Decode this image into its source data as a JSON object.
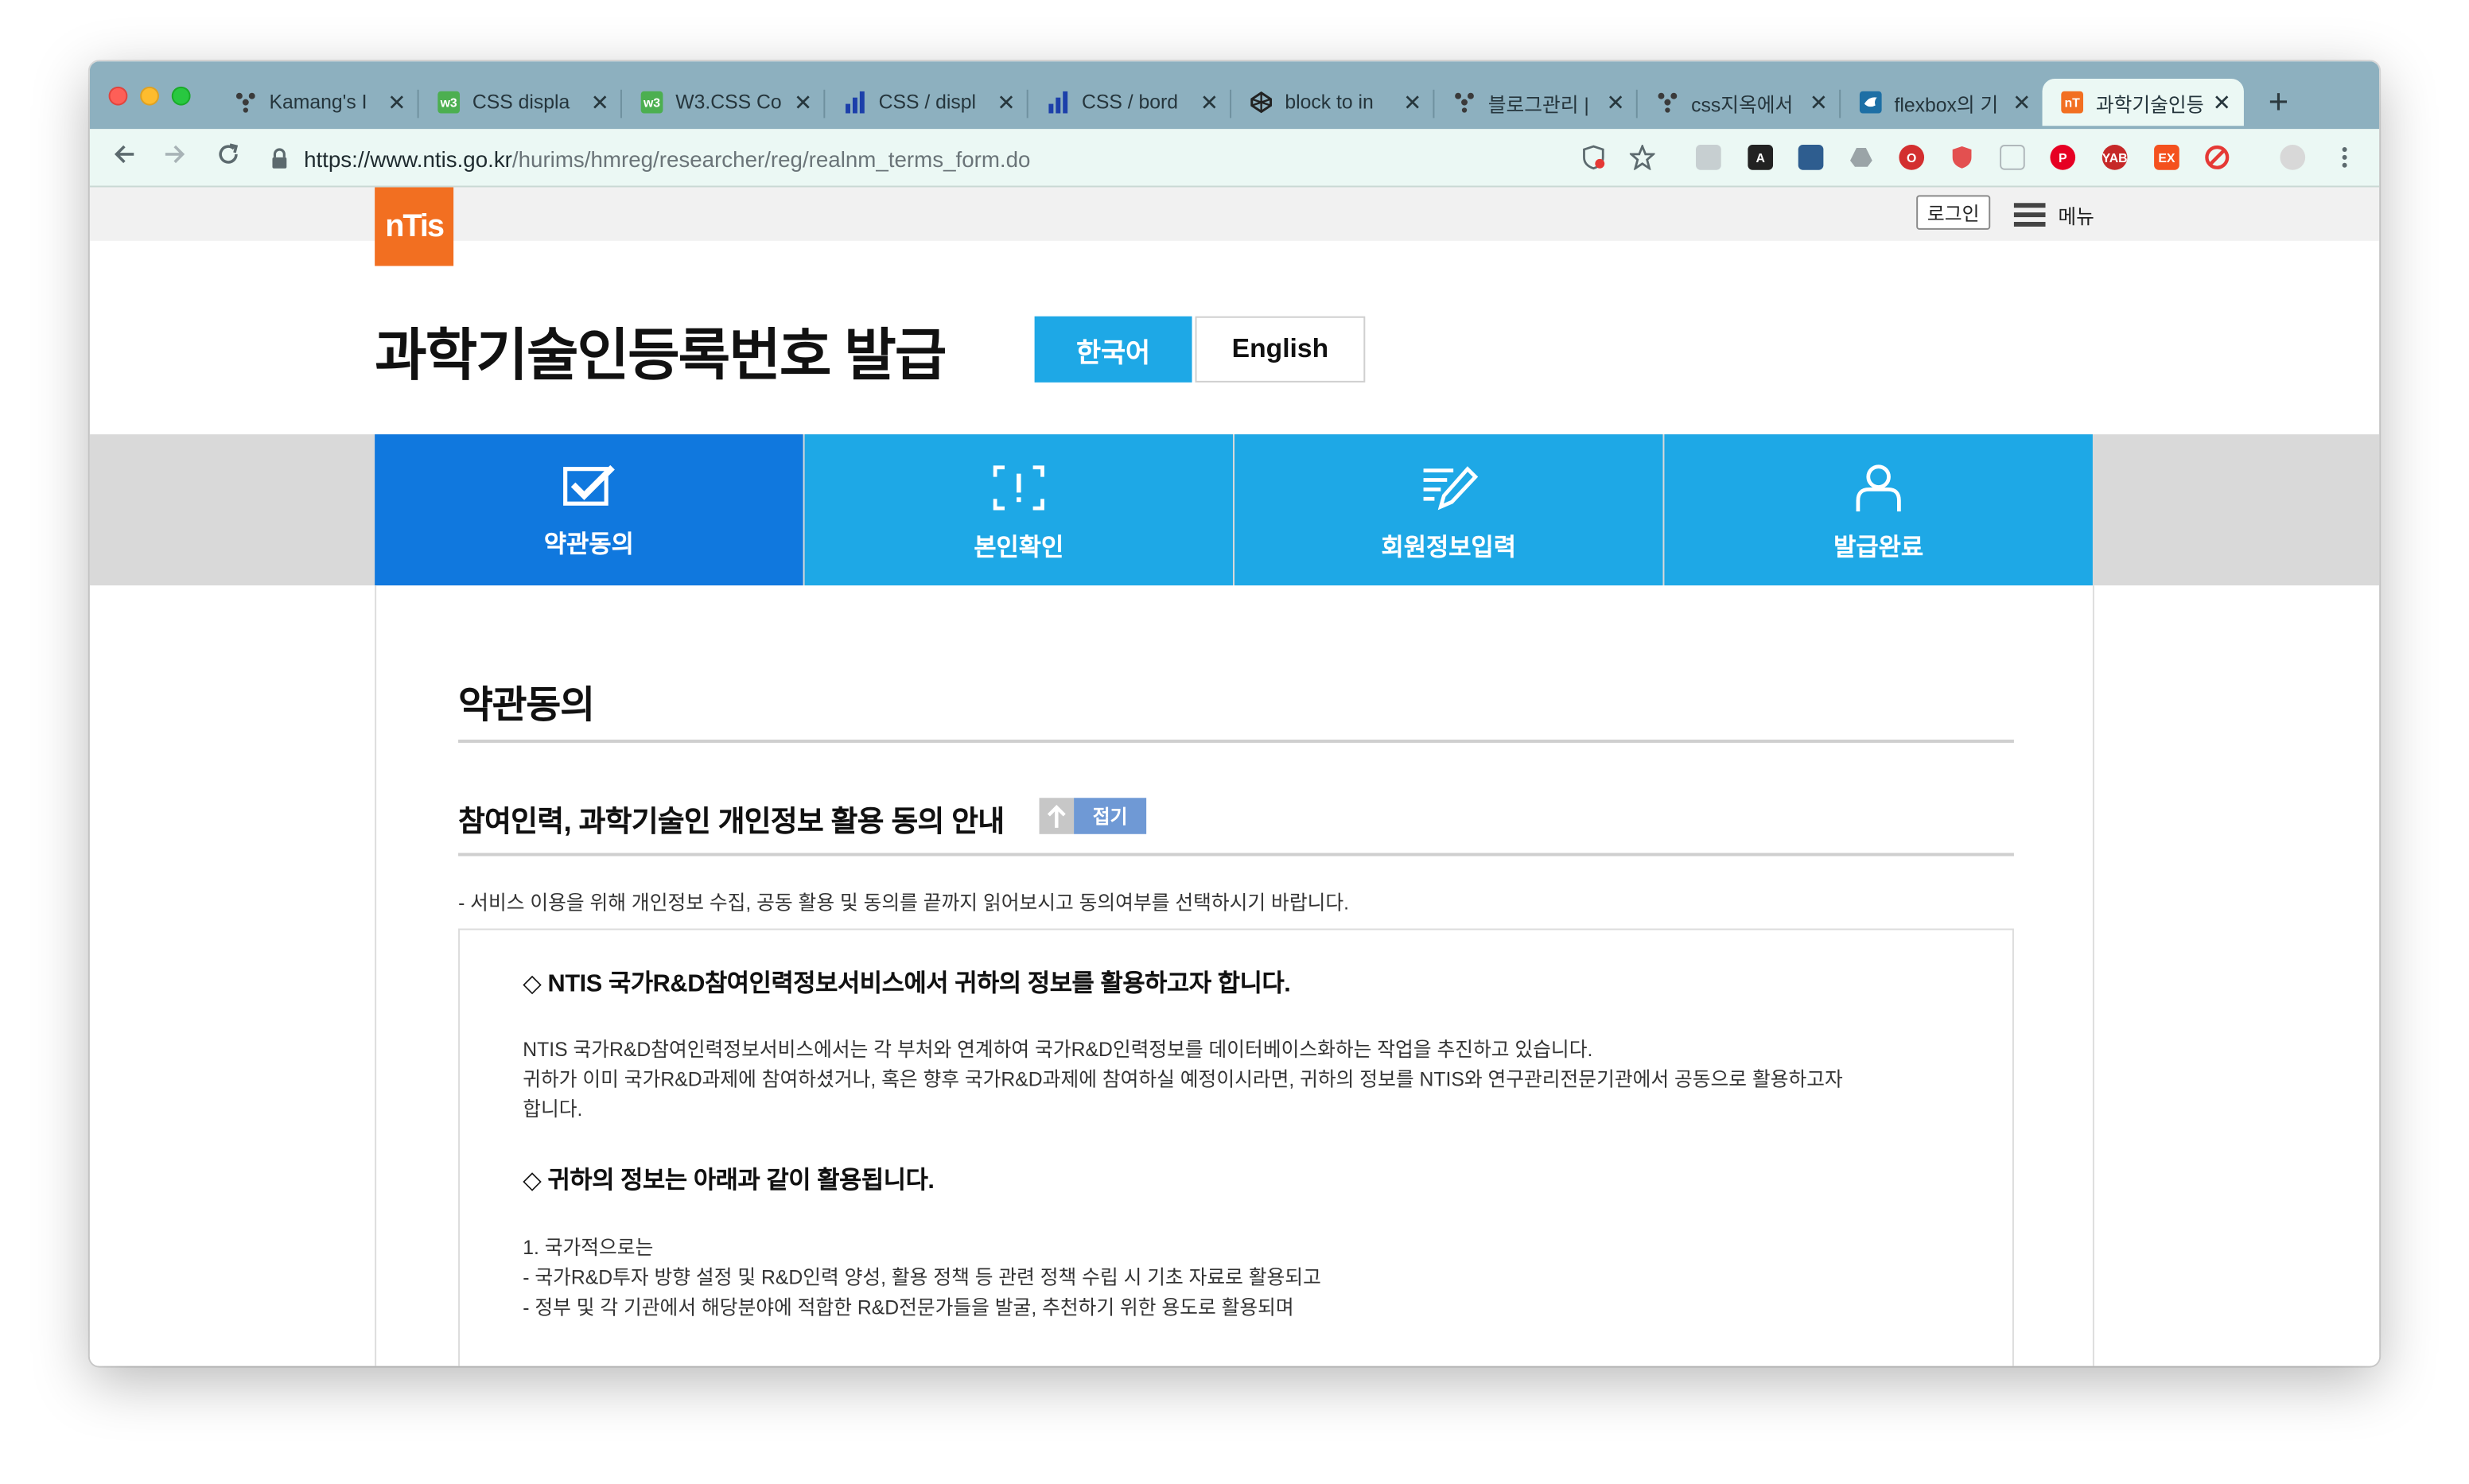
{
  "browser": {
    "tabs": [
      {
        "title": "Kamang's I",
        "favicon": "tinder-like-icon",
        "color": "#3a3a3a"
      },
      {
        "title": "CSS displa",
        "favicon": "w3-icon",
        "color": "#4caf50"
      },
      {
        "title": "W3.CSS Co",
        "favicon": "w3-icon",
        "color": "#4caf50"
      },
      {
        "title": "CSS / displ",
        "favicon": "bar-chart-icon",
        "color": "#1c3faa"
      },
      {
        "title": "CSS / bord",
        "favicon": "bar-chart-icon",
        "color": "#1c3faa"
      },
      {
        "title": "block to in",
        "favicon": "codepen-icon",
        "color": "#222222"
      },
      {
        "title": "블로그관리 |",
        "favicon": "tinder-like-icon",
        "color": "#3a3a3a"
      },
      {
        "title": "css지옥에서",
        "favicon": "tinder-like-icon",
        "color": "#3a3a3a"
      },
      {
        "title": "flexbox의 기",
        "favicon": "bird-icon",
        "color": "#1d6fa5"
      },
      {
        "title": "과학기술인등",
        "favicon": "ntis-icon",
        "color": "#f26f21"
      }
    ],
    "close_glyph": "✕",
    "new_tab_glyph": "+",
    "url_host": "https://www.ntis.go.kr",
    "url_path": "/hurims/hmreg/researcher/reg/realnm_terms_form.do"
  },
  "header": {
    "logo_text": "nTis",
    "login_label": "로그인",
    "menu_label": "메뉴"
  },
  "page": {
    "title": "과학기술인등록번호 발급",
    "lang_ko": "한국어",
    "lang_en": "English"
  },
  "steps": [
    {
      "label": "약관동의",
      "icon": "checkbox-icon",
      "active": true
    },
    {
      "label": "본인확인",
      "icon": "scan-frame-icon",
      "active": false
    },
    {
      "label": "회원정보입력",
      "icon": "edit-document-icon",
      "active": false
    },
    {
      "label": "발급완료",
      "icon": "person-icon",
      "active": false
    }
  ],
  "content": {
    "heading": "약관동의",
    "section_title": "참여인력, 과학기술인 개인정보 활용 동의 안내",
    "fold_label": "접기",
    "guide": "- 서비스 이용을 위해 개인정보 수집, 공동 활용 및 동의를 끝까지 읽어보시고 동의여부를 선택하시기 바랍니다.",
    "terms": {
      "heading1": "◇ NTIS 국가R&D참여인력정보서비스에서 귀하의 정보를 활용하고자 합니다.",
      "para1_line1": "NTIS 국가R&D참여인력정보서비스에서는 각 부처와 연계하여 국가R&D인력정보를 데이터베이스화하는 작업을 추진하고 있습니다.",
      "para1_line2": " 귀하가 이미 국가R&D과제에 참여하셨거나, 혹은 향후 국가R&D과제에 참여하실 예정이시라면, 귀하의 정보를 NTIS와 연구관리전문기관에서 공동으로 활용하고자",
      "para1_line3": "합니다.",
      "heading2": "◇ 귀하의 정보는 아래과 같이 활용됩니다.",
      "list1_title": "1. 국가적으로는",
      "list1_item1": " - 국가R&D투자 방향 설정 및 R&D인력 양성, 활용 정책 등 관련 정책 수립 시 기초 자료로 활용되고",
      "list1_item2": " - 정부 및 각 기관에서 해당분야에 적합한 R&D전문가들을 발굴, 추천하기 위한 용도로 활용되며"
    }
  },
  "colors": {
    "tabstrip": "#8db0bf",
    "toolbar": "#ebf8f4",
    "step_active": "#1078de",
    "step": "#1ea8e6",
    "lang_active": "#1ea8e6",
    "logo": "#f26f21",
    "fold_button": "#6f99d5"
  }
}
